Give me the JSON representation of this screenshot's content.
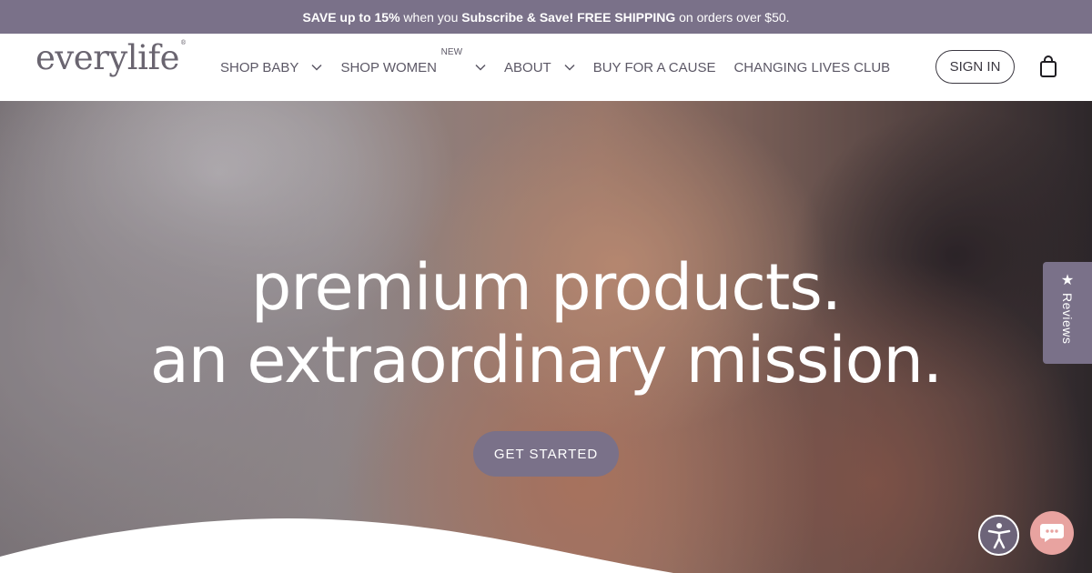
{
  "promo": {
    "part1": "SAVE up to 15%",
    "part2": " when you ",
    "part3": "Subscribe & Save!",
    "part4": " FREE SHIPPING",
    "part5": " on orders over $50."
  },
  "header": {
    "logo": "everylife",
    "nav": [
      {
        "label": "SHOP BABY",
        "has_dropdown": true
      },
      {
        "label": "SHOP WOMEN",
        "badge": "NEW",
        "has_dropdown": true
      },
      {
        "label": "ABOUT",
        "has_dropdown": true
      },
      {
        "label": "BUY FOR A CAUSE"
      },
      {
        "label": "CHANGING LIVES CLUB"
      }
    ],
    "sign_in": "SIGN IN",
    "cart_icon": "shopping-bag-icon"
  },
  "hero": {
    "headline_line1": "premium products.",
    "headline_line2": "an extraordinary mission.",
    "cta": "GET STARTED"
  },
  "widgets": {
    "reviews_label": "Reviews",
    "reviews_icon": "star-icon",
    "accessibility_icon": "accessibility-icon",
    "chat_icon": "chat-bubble-icon"
  },
  "colors": {
    "brand_purple": "#7a7189",
    "chat_pink": "#e8a3a0",
    "text_dark": "#3b3841"
  }
}
